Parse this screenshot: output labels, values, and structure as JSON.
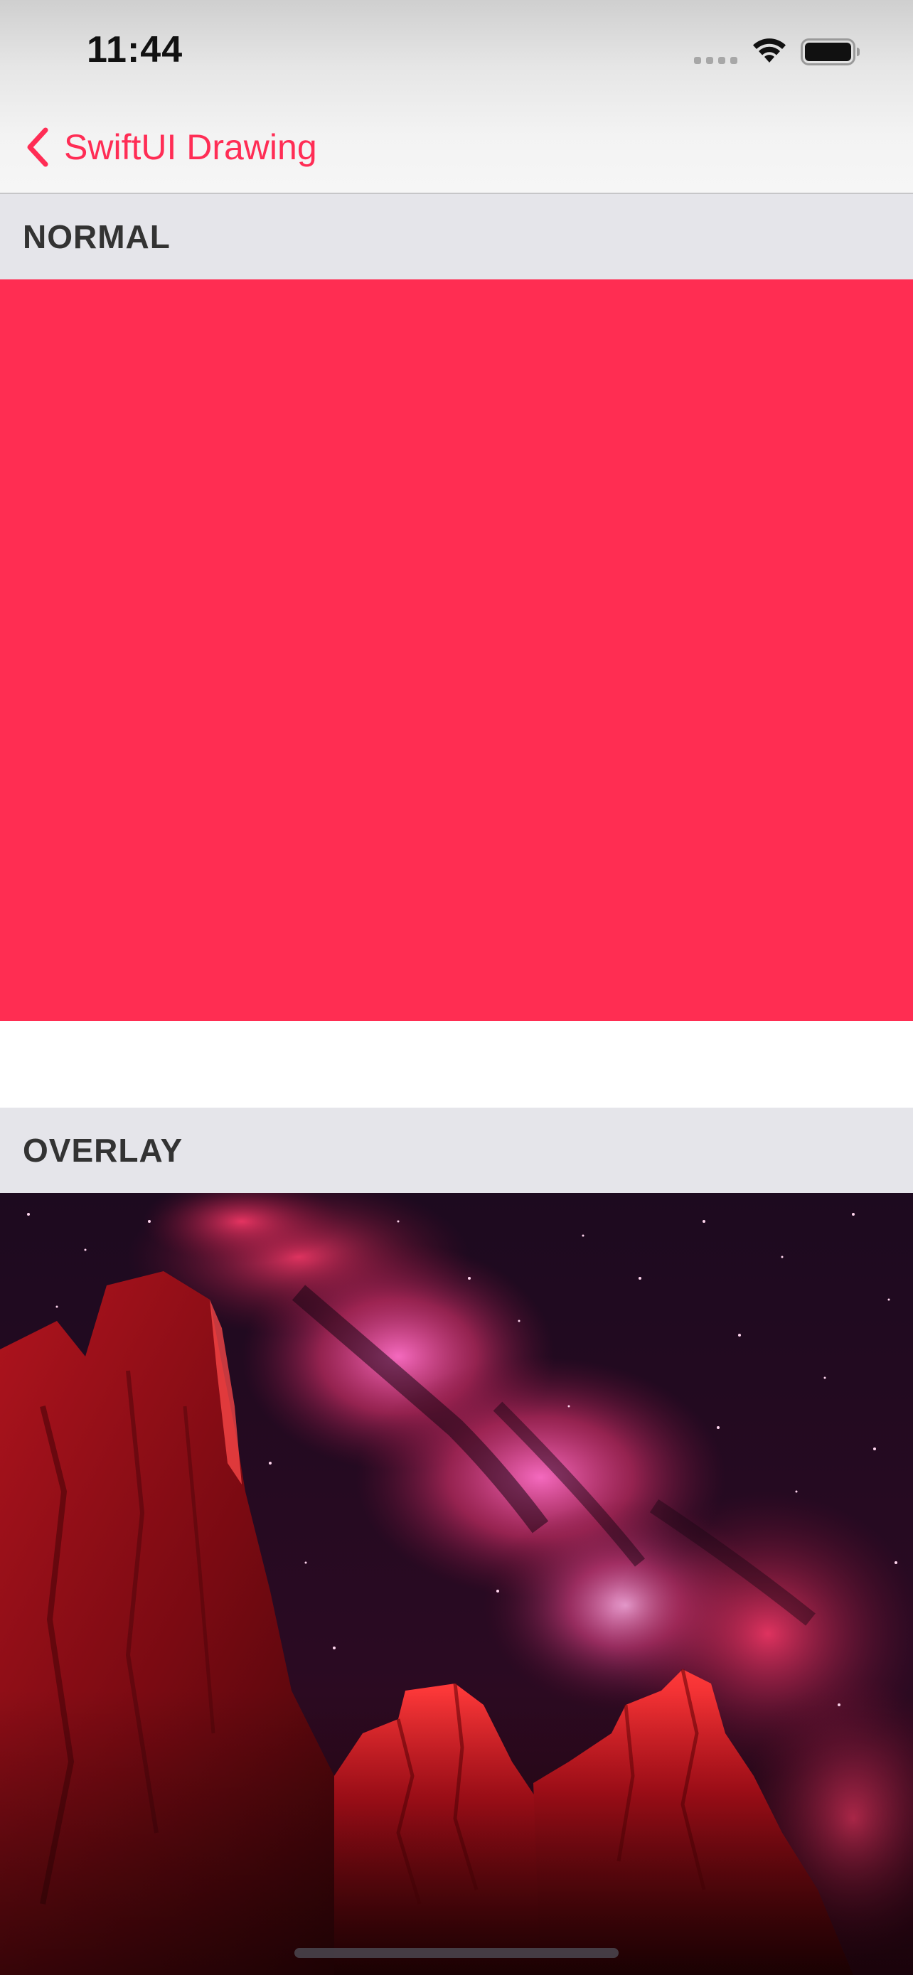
{
  "status_bar": {
    "time": "11:44"
  },
  "nav": {
    "back_label": "SwiftUI Drawing",
    "back_icon": "chevron-left-icon"
  },
  "sections": {
    "normal": {
      "title": "NORMAL",
      "fill_color": "#ff2d52"
    },
    "overlay": {
      "title": "OVERLAY",
      "image_description_icon": "photo"
    }
  },
  "colors": {
    "accent": "#ff2d55",
    "section_header_bg": "#e5e5ea",
    "section_header_text": "#333333"
  }
}
